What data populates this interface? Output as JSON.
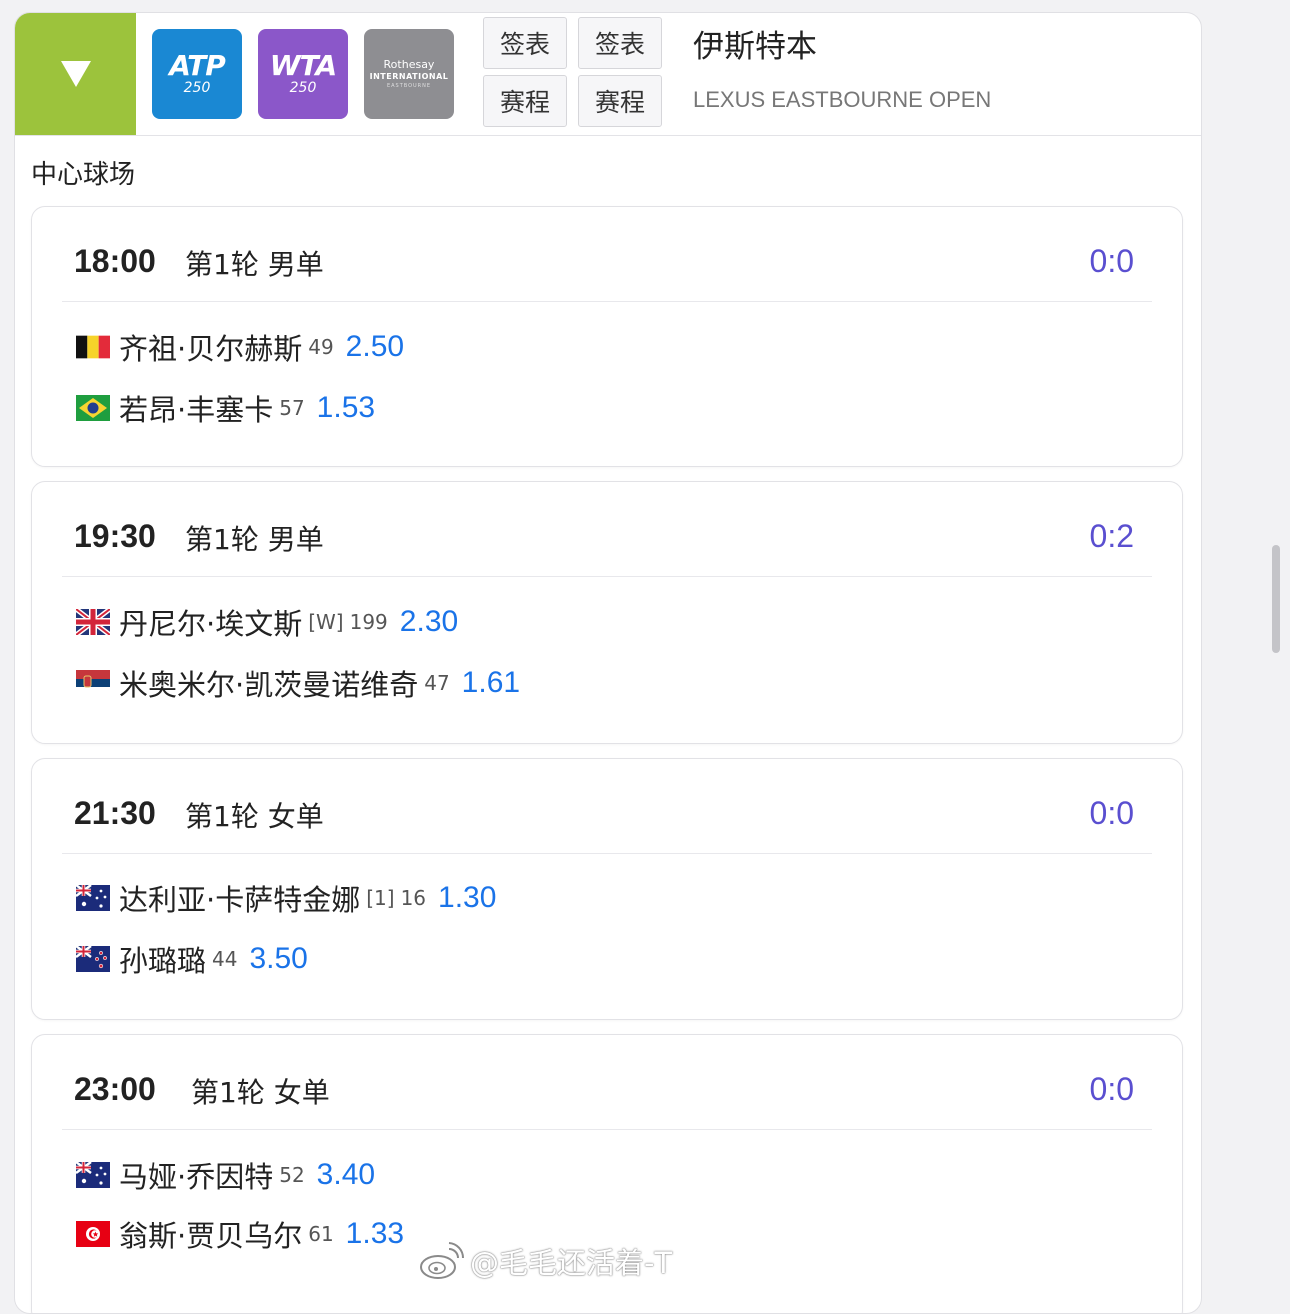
{
  "header": {
    "logos": {
      "atp_main": "ATP",
      "atp_sub": "250",
      "wta_main": "WTA",
      "wta_sub": "250",
      "roth_line1": "Rothesay",
      "roth_line2": "INTERNATIONAL",
      "roth_line3": "EASTBOURNE"
    },
    "buttons": [
      {
        "label": "签表"
      },
      {
        "label": "签表"
      },
      {
        "label": "赛程"
      },
      {
        "label": "赛程"
      }
    ],
    "tournament_name": "伊斯特本",
    "tournament_name_en": "LEXUS EASTBOURNE OPEN"
  },
  "court_name": "中心球场",
  "matches": [
    {
      "time": "18:00",
      "round": "第1轮 男单",
      "score": "0:0",
      "players": [
        {
          "flag": "belgium-flag",
          "name": "齐祖·贝尔赫斯",
          "seed": "",
          "rank": "49",
          "odds": "2.50"
        },
        {
          "flag": "brazil-flag",
          "name": "若昂·丰塞卡",
          "seed": "",
          "rank": "57",
          "odds": "1.53"
        }
      ]
    },
    {
      "time": "19:30",
      "round": "第1轮 男单",
      "score": "0:2",
      "players": [
        {
          "flag": "uk-flag",
          "name": "丹尼尔·埃文斯",
          "seed": "[W]",
          "rank": "199",
          "odds": "2.30"
        },
        {
          "flag": "serbia-flag",
          "name": "米奥米尔·凯茨曼诺维奇",
          "seed": "",
          "rank": "47",
          "odds": "1.61"
        }
      ]
    },
    {
      "time": "21:30",
      "round": "第1轮 女单",
      "score": "0:0",
      "players": [
        {
          "flag": "australia-flag",
          "name": "达利亚·卡萨特金娜",
          "seed": "[1]",
          "rank": "16",
          "odds": "1.30"
        },
        {
          "flag": "new-zealand-flag",
          "name": "孙璐璐",
          "seed": "",
          "rank": "44",
          "odds": "3.50"
        }
      ]
    },
    {
      "time": "23:00",
      "round": "第1轮 女单",
      "score": "0:0",
      "players": [
        {
          "flag": "australia-flag",
          "name": "马娅·乔因特",
          "seed": "",
          "rank": "52",
          "odds": "3.40"
        },
        {
          "flag": "tunisia-flag",
          "name": "翁斯·贾贝乌尔",
          "seed": "",
          "rank": "61",
          "odds": "1.33"
        }
      ]
    }
  ],
  "watermark": "@毛毛还活着-T",
  "colors": {
    "accent_green": "#9cc33c",
    "atp_blue": "#1a88d3",
    "wta_purple": "#8b57c9",
    "odds_blue": "#1a73e8",
    "score_purple": "#5a4fd0"
  }
}
